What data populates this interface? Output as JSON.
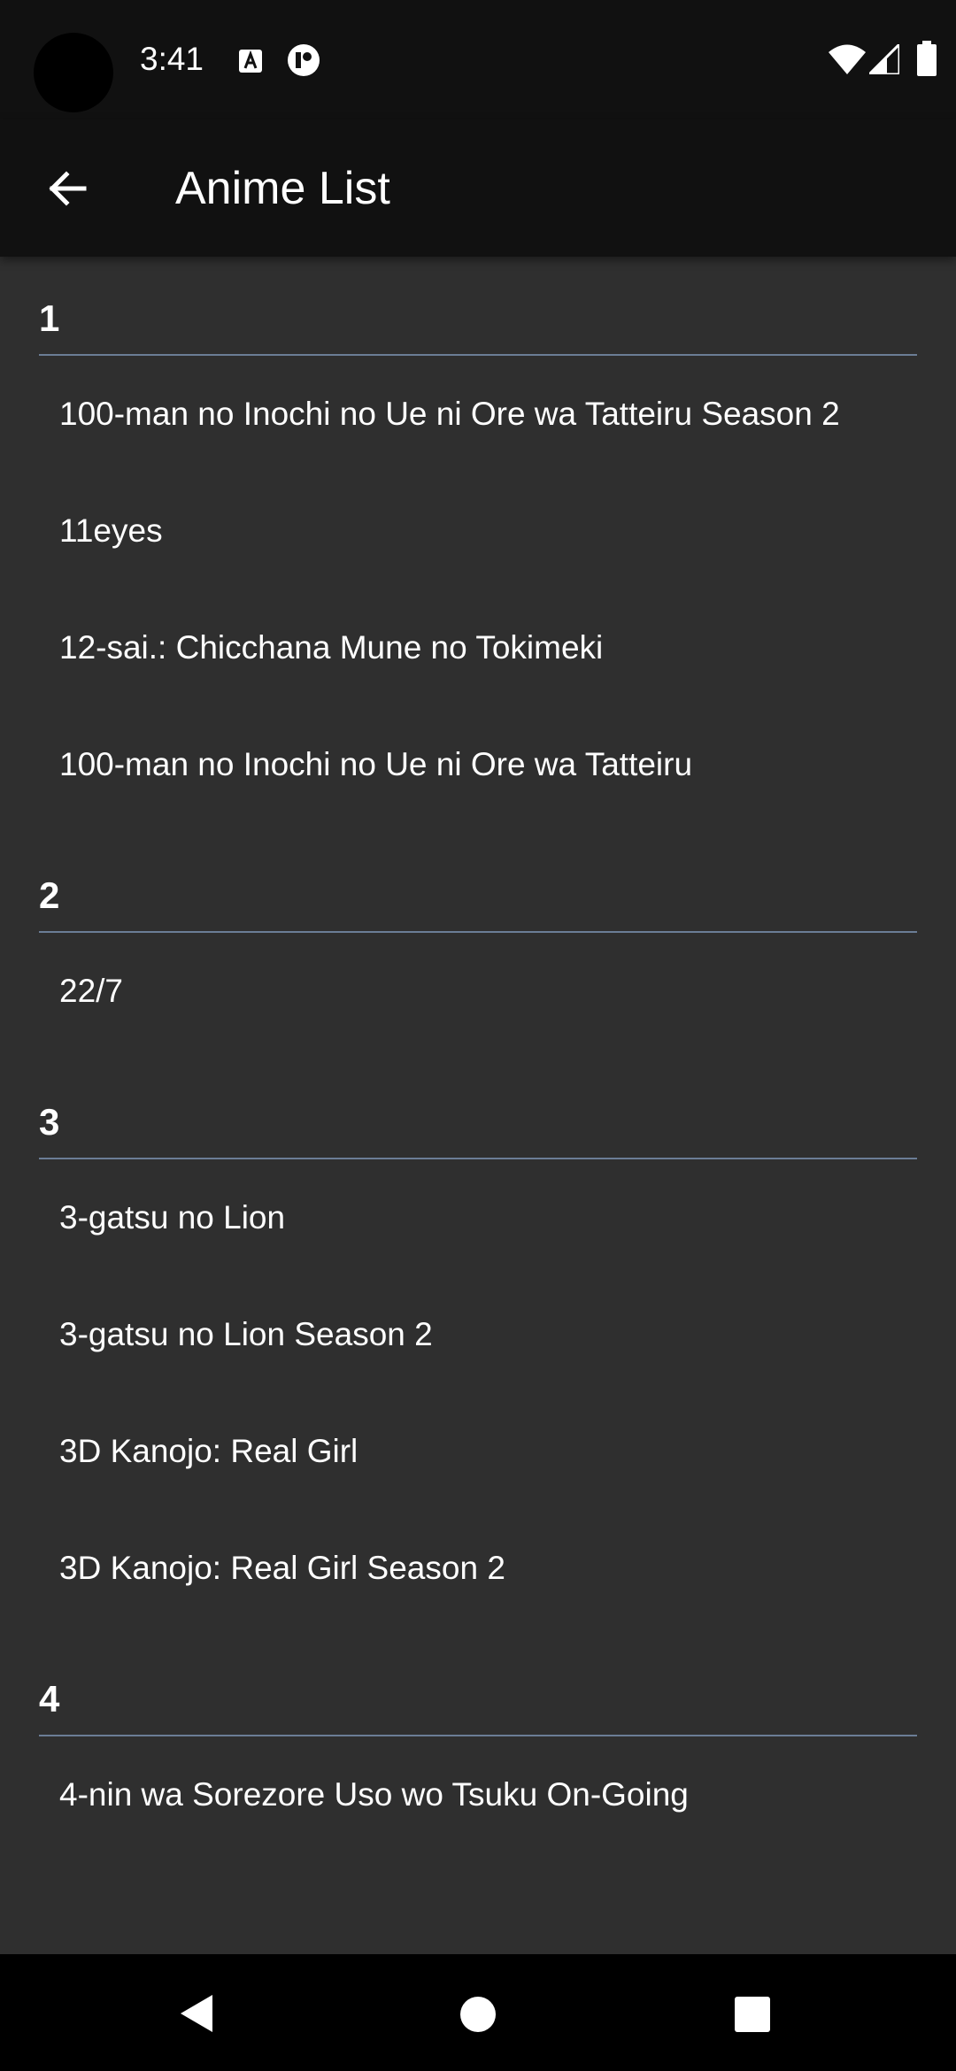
{
  "status_bar": {
    "time": "3:41",
    "icons": [
      "text-a-notification-icon",
      "app-notification-icon",
      "wifi-icon",
      "signal-icon",
      "battery-icon"
    ]
  },
  "app_bar": {
    "title": "Anime List",
    "back_icon": "arrow-left-icon"
  },
  "sections": [
    {
      "letter": "1",
      "items": [
        "100-man no Inochi no Ue ni Ore wa Tatteiru Season 2",
        "11eyes",
        "12-sai.: Chicchana Mune no Tokimeki",
        "100-man no Inochi no Ue ni Ore wa Tatteiru"
      ]
    },
    {
      "letter": "2",
      "items": [
        "22/7"
      ]
    },
    {
      "letter": "3",
      "items": [
        "3-gatsu no Lion",
        "3-gatsu no Lion Season 2",
        "3D Kanojo: Real Girl",
        "3D Kanojo: Real Girl Season 2"
      ]
    },
    {
      "letter": "4",
      "items": [
        "4-nin wa Sorezore Uso wo Tsuku On-Going"
      ]
    }
  ],
  "colors": {
    "background": "#2f2f2f",
    "bar": "#111111",
    "divider": "#6b7d96",
    "nav_bar": "#000000"
  },
  "nav_bar": {
    "icons": [
      "back-triangle-icon",
      "home-circle-icon",
      "recents-square-icon"
    ]
  }
}
